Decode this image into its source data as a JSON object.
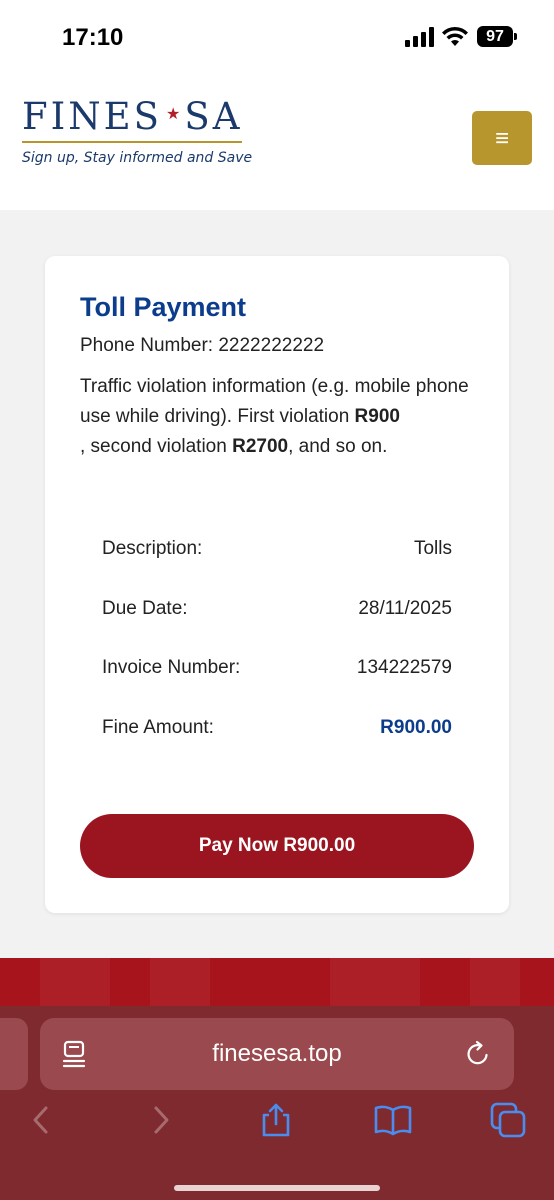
{
  "status_bar": {
    "time": "17:10",
    "battery": "97"
  },
  "header": {
    "logo_left": "FINES",
    "logo_right": "SA",
    "tagline": "Sign up, Stay informed and Save",
    "menu_icon": "hamburger-icon"
  },
  "card": {
    "title": "Toll Payment",
    "phone_label": "Phone Number:",
    "phone_value": "2222222222",
    "violation": {
      "part1": "Traffic violation information (e.g. mobile phone use while driving). First violation ",
      "first_amount": "R900",
      "part2": " , second violation ",
      "second_amount": "R2700",
      "part3": ", and so on."
    },
    "details": [
      {
        "label": "Description:",
        "value": "Tolls"
      },
      {
        "label": "Due Date:",
        "value": "28/11/2025"
      },
      {
        "label": "Invoice Number:",
        "value": "134222579"
      },
      {
        "label": "Fine Amount:",
        "value": "R900.00"
      }
    ],
    "pay_button": "Pay Now R900.00"
  },
  "browser": {
    "url": "finesesa.top",
    "icons": [
      "reader-icon",
      "reload-icon",
      "back-icon",
      "forward-icon",
      "share-icon",
      "bookmarks-icon",
      "tabs-icon"
    ]
  },
  "colors": {
    "brand_navy": "#1b3a6b",
    "title_blue": "#0c3c8c",
    "gold": "#b8962e",
    "button_red": "#9b1520",
    "safari_tint": "#7f2a2f"
  }
}
